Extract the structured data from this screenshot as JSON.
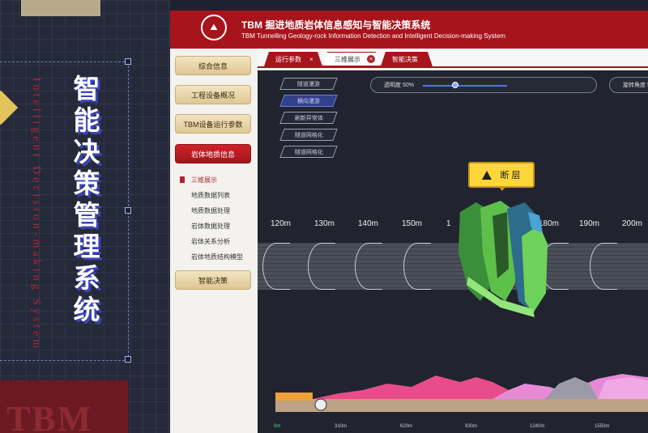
{
  "left_panel": {
    "title_cn": "智能决策管理系统",
    "title_en": "Intelligent Decision-making System",
    "watermark": "TBM"
  },
  "header": {
    "logo_text": "校徽",
    "title": "TBM 掘进地质岩体信息感知与智能决策系统",
    "subtitle": "TBM Tunnelling Geology-rock Information Detection and Intelligent Decision-making System"
  },
  "sidebar": {
    "items": [
      {
        "label": "综合信息"
      },
      {
        "label": "工程设备概况"
      },
      {
        "label": "TBM设备运行参数"
      },
      {
        "label": "岩体地质信息"
      },
      {
        "label": "智能决策"
      }
    ],
    "subitems": [
      {
        "label": "三维展示"
      },
      {
        "label": "地质数据列表"
      },
      {
        "label": "地质数据处理"
      },
      {
        "label": "岩体数据处理"
      },
      {
        "label": "岩体关系分析"
      },
      {
        "label": "岩体地质结构模型"
      }
    ]
  },
  "tabs": [
    {
      "label": "运行参数",
      "close": "×"
    },
    {
      "label": "三维展示",
      "close": "×"
    },
    {
      "label": "智能决策",
      "close": "×"
    }
  ],
  "view": {
    "side_buttons": [
      "隧道漫游",
      "横向漫游",
      "刷新异常体",
      "隧道网格化",
      "隧道网格化"
    ],
    "opacity_label": "透明度 50%",
    "opacity_value": 0.5,
    "rotation_label": "旋转角度 5",
    "warning_label": "断 层",
    "mileage_labels": [
      "120m",
      "130m",
      "140m",
      "150m",
      "1",
      "0m",
      "180m",
      "190m",
      "200m"
    ],
    "axis_labels": [
      "0m",
      "310m",
      "620m",
      "930m",
      "1240m",
      "1550m"
    ]
  },
  "colors": {
    "brand_red": "#a8141c",
    "gold": "#e3cd9b",
    "accent_blue": "#5177e6",
    "warning_yellow": "#fdd63a"
  }
}
